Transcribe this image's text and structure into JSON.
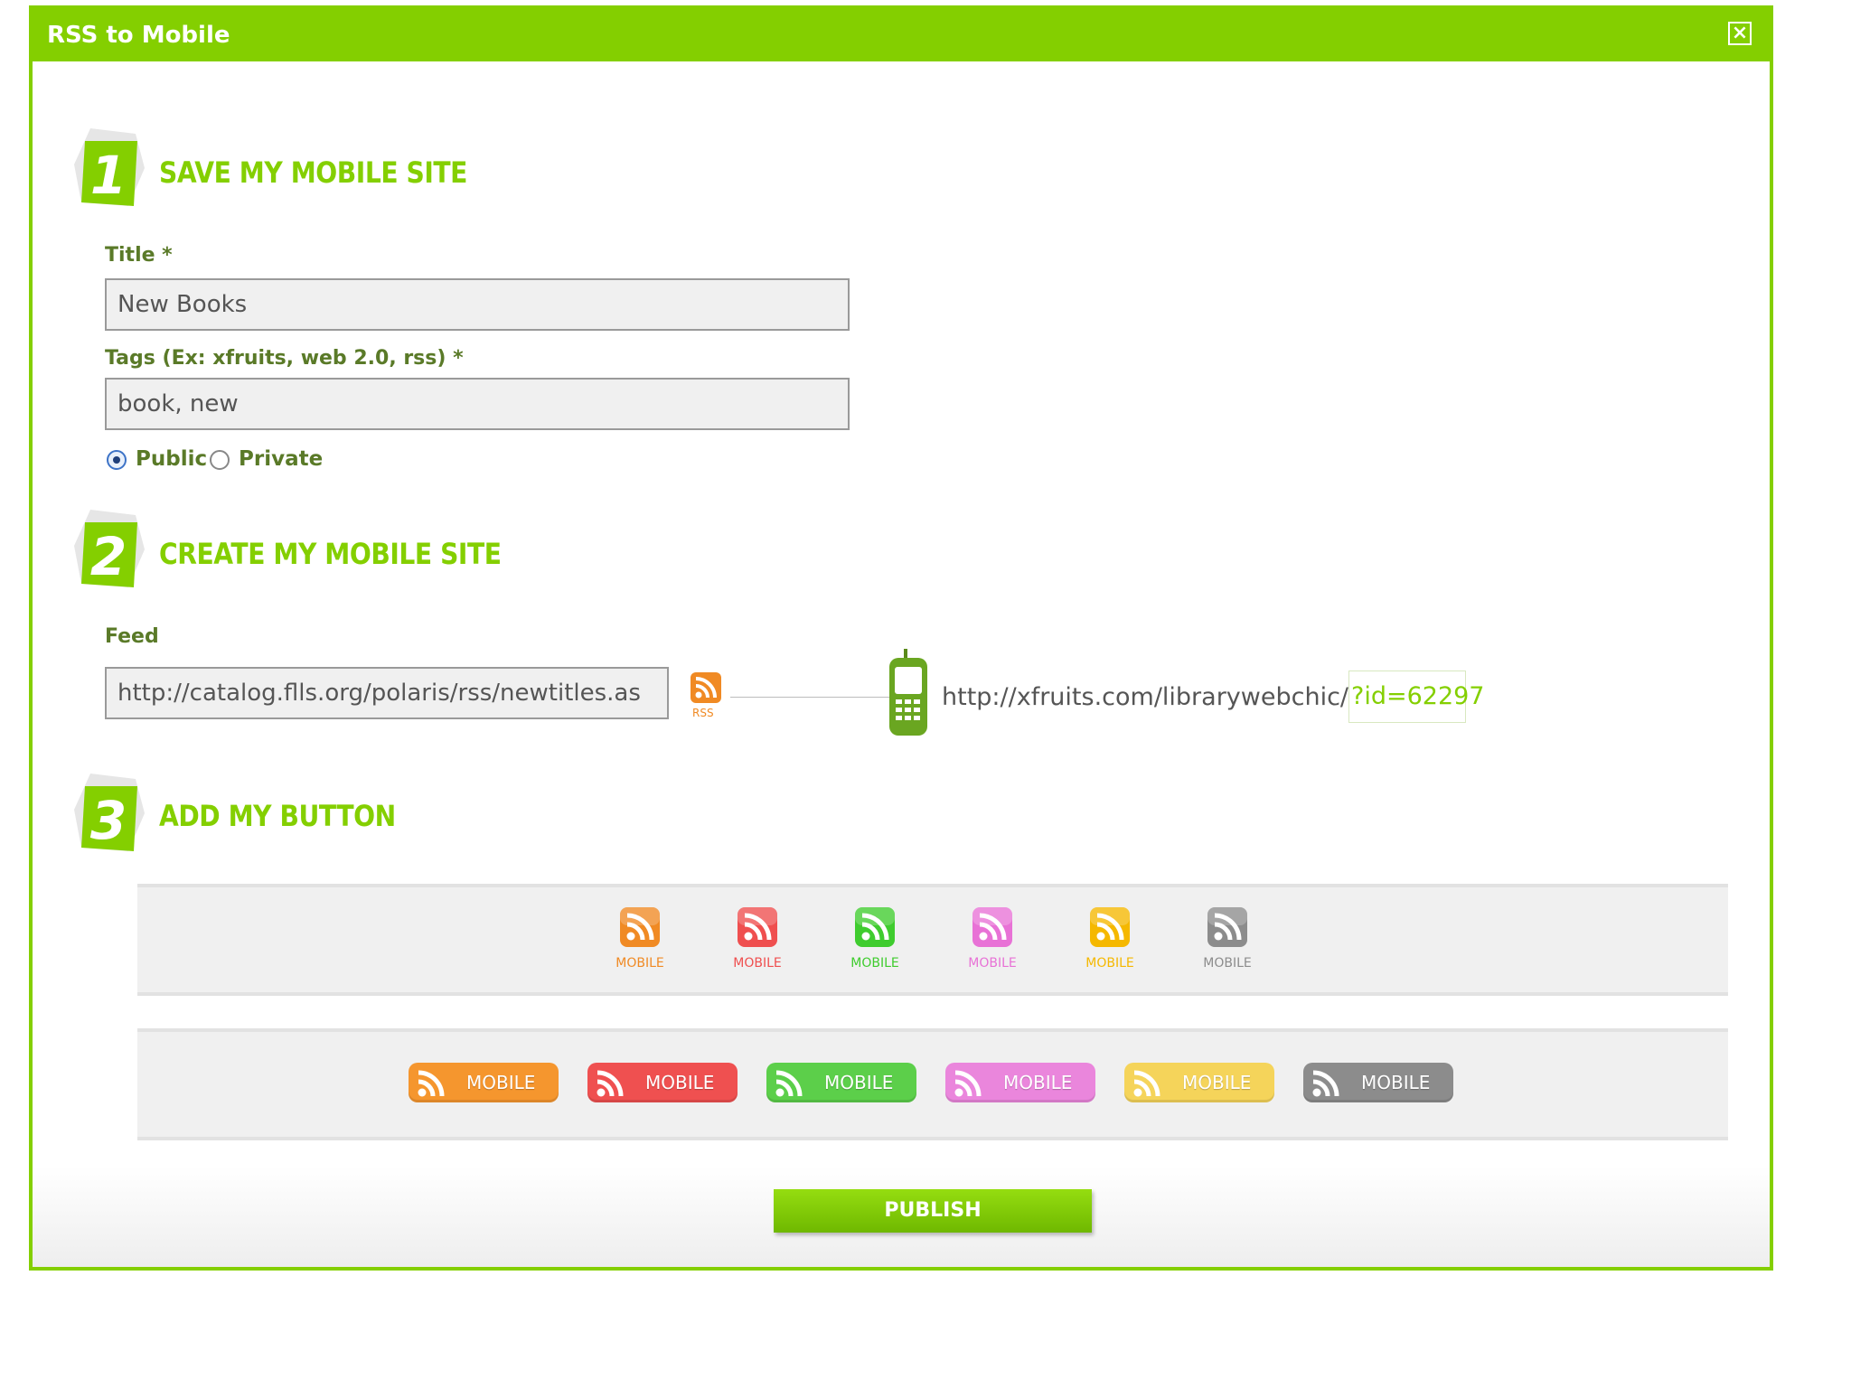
{
  "window": {
    "title": "RSS to Mobile",
    "close_icon": "close-icon"
  },
  "step1": {
    "number": "1",
    "title": "SAVE MY MOBILE SITE",
    "title_label": "Title *",
    "title_value": "New Books",
    "tags_label": "Tags (Ex: xfruits, web 2.0, rss) *",
    "tags_value": "book, new",
    "visibility": {
      "public_label": "Public",
      "private_label": "Private",
      "selected": "Public"
    }
  },
  "step2": {
    "number": "2",
    "title": "CREATE MY MOBILE SITE",
    "feed_label": "Feed",
    "feed_value": "http://catalog.flls.org/polaris/rss/newtitles.as",
    "rss_badge": "RSS",
    "mobile_url": "http://xfruits.com/librarywebchic/",
    "mobile_id": "?id=62297"
  },
  "step3": {
    "number": "3",
    "title": "ADD MY BUTTON",
    "icon_buttons": [
      {
        "label": "MOBILE",
        "color": "#f08a24"
      },
      {
        "label": "MOBILE",
        "color": "#ef4f4f"
      },
      {
        "label": "MOBILE",
        "color": "#3fcc2e"
      },
      {
        "label": "MOBILE",
        "color": "#e872d6"
      },
      {
        "label": "MOBILE",
        "color": "#f5b800"
      },
      {
        "label": "MOBILE",
        "color": "#8c8c8c"
      }
    ],
    "pill_buttons": [
      {
        "label": "MOBILE",
        "color": "#f5962e"
      },
      {
        "label": "MOBILE",
        "color": "#ef5050"
      },
      {
        "label": "MOBILE",
        "color": "#5ccf4a"
      },
      {
        "label": "MOBILE",
        "color": "#ea86dc"
      },
      {
        "label": "MOBILE",
        "color": "#f5d45a"
      },
      {
        "label": "MOBILE",
        "color": "#8c8c8c"
      }
    ]
  },
  "publish_label": "PUBLISH",
  "colors": {
    "brand": "#84cf00",
    "label_text": "#5a7a28"
  }
}
